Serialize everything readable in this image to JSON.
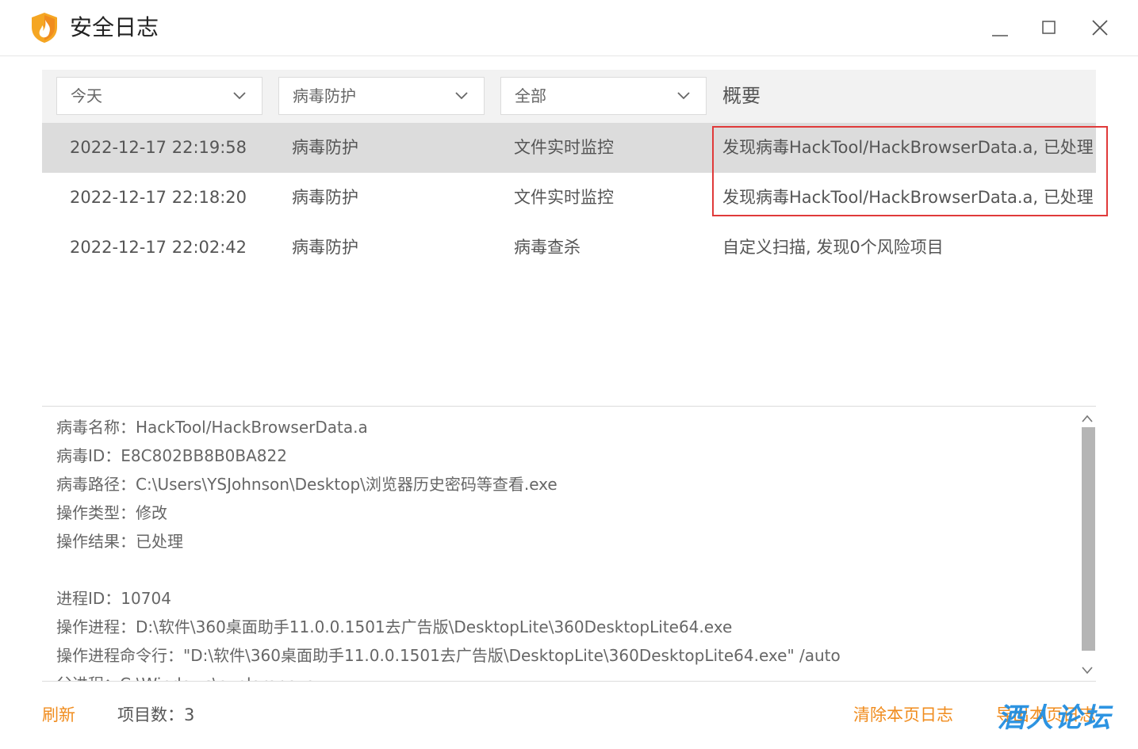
{
  "window": {
    "title": "安全日志",
    "minimize_label": "—",
    "colors": {
      "accent": "#f08c1e",
      "highlight": "#e03a3a",
      "selected_row": "#dcdcdc"
    }
  },
  "filters": {
    "date": "今天",
    "module": "病毒防护",
    "type": "全部",
    "summary_header": "概要"
  },
  "log_rows": [
    {
      "time": "2022-12-17 22:19:58",
      "module": "病毒防护",
      "type": "文件实时监控",
      "summary": "发现病毒HackTool/HackBrowserData.a, 已处理",
      "selected": true
    },
    {
      "time": "2022-12-17 22:18:20",
      "module": "病毒防护",
      "type": "文件实时监控",
      "summary": "发现病毒HackTool/HackBrowserData.a, 已处理",
      "selected": false
    },
    {
      "time": "2022-12-17 22:02:42",
      "module": "病毒防护",
      "type": "病毒查杀",
      "summary": "自定义扫描, 发现0个风险项目",
      "selected": false
    }
  ],
  "detail": {
    "lines": [
      "病毒名称：HackTool/HackBrowserData.a",
      "病毒ID：E8C802BB8B0BA822",
      "病毒路径：C:\\Users\\YSJohnson\\Desktop\\浏览器历史密码等查看.exe",
      "操作类型：修改",
      "操作结果：已处理",
      "",
      "进程ID：10704",
      "操作进程：D:\\软件\\360桌面助手11.0.0.1501去广告版\\DesktopLite\\360DesktopLite64.exe",
      "操作进程命令行：\"D:\\软件\\360桌面助手11.0.0.1501去广告版\\DesktopLite\\360DesktopLite64.exe\" /auto",
      "父进程：C:\\Windows\\explorer.exe"
    ]
  },
  "footer": {
    "refresh": "刷新",
    "item_count": "项目数：3",
    "clear": "清除本页日志",
    "export": "导出本页日志",
    "watermark": "酒人论坛"
  }
}
